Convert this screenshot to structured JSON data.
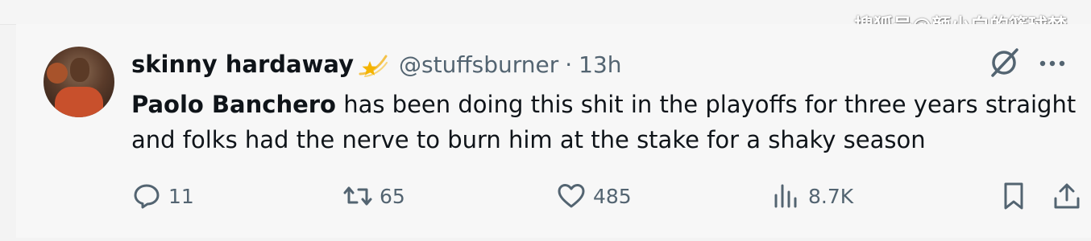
{
  "watermark": "搜狐号@颜小白的篮球梦",
  "tweet": {
    "author_name": "skinny hardaway",
    "author_handle": "@stuffsburner",
    "separator": "·",
    "timestamp": "13h",
    "mention": "Paolo Banchero",
    "text_rest": " has been doing this shit in the playoffs for three years straight and folks had the nerve to burn him at the stake for a shaky season"
  },
  "actions": {
    "reply_count": "11",
    "retweet_count": "65",
    "like_count": "485",
    "views_count": "8.7K"
  },
  "icons": {
    "badge": "shooting-star-icon",
    "grok": "grok-slash-icon",
    "more": "more-dots-icon",
    "reply": "reply-bubble-icon",
    "retweet": "retweet-icon",
    "like": "heart-icon",
    "views": "views-bar-chart-icon",
    "bookmark": "bookmark-icon",
    "share": "share-upload-icon"
  },
  "colors": {
    "text": "#0f1419",
    "muted": "#536471",
    "badge_gold": "#f4b400",
    "background": "#f7f7f7"
  }
}
